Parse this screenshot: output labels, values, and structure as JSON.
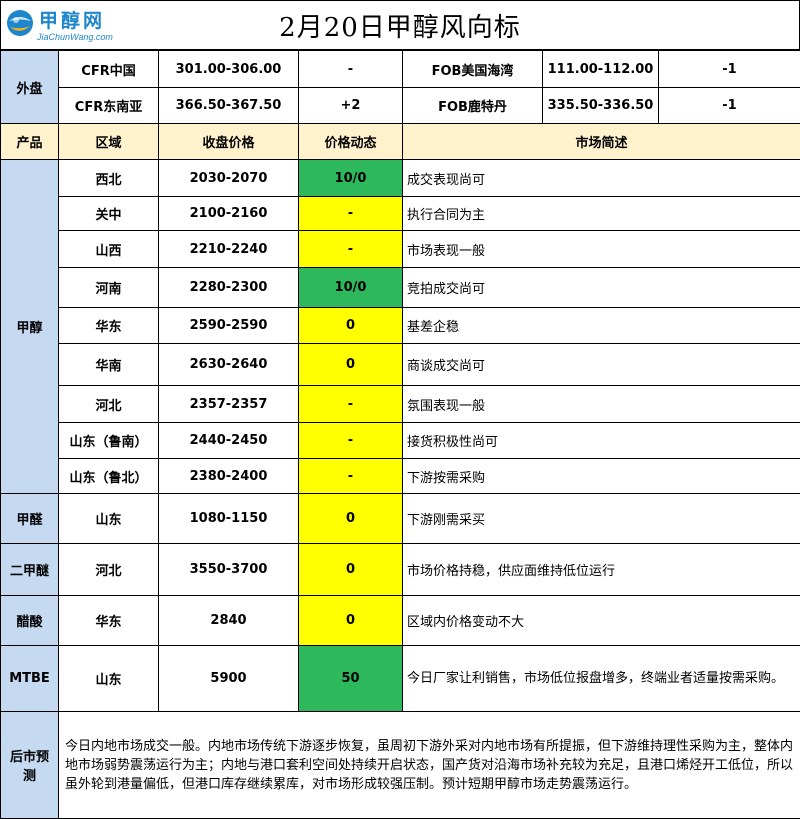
{
  "header": {
    "logo_text": "甲醇网",
    "logo_sub": "JiaChunWang.com",
    "title": "2月20日甲醇风向标"
  },
  "external": {
    "label": "外盘",
    "rows": [
      {
        "left_name": "CFR中国",
        "left_price": "301.00-306.00",
        "left_change": "-",
        "right_name": "FOB美国海湾",
        "right_price": "111.00-112.00",
        "right_change": "-1"
      },
      {
        "left_name": "CFR东南亚",
        "left_price": "366.50-367.50",
        "left_change": "+2",
        "right_name": "FOB鹿特丹",
        "right_price": "335.50-336.50",
        "right_change": "-1"
      }
    ]
  },
  "columns": {
    "product": "产品",
    "region": "区域",
    "price": "收盘价格",
    "change": "价格动态",
    "summary": "市场简述"
  },
  "methanol": {
    "product": "甲醇",
    "rows": [
      {
        "region": "西北",
        "price": "2030-2070",
        "change": "10/0",
        "summary": "成交表现尚可"
      },
      {
        "region": "关中",
        "price": "2100-2160",
        "change": "-",
        "summary": "执行合同为主"
      },
      {
        "region": "山西",
        "price": "2210-2240",
        "change": "-",
        "summary": "市场表现一般"
      },
      {
        "region": "河南",
        "price": "2280-2300",
        "change": "10/0",
        "summary": "竞拍成交尚可"
      },
      {
        "region": "华东",
        "price": "2590-2590",
        "change": "0",
        "summary": "基差企稳"
      },
      {
        "region": "华南",
        "price": "2630-2640",
        "change": "0",
        "summary": "商谈成交尚可"
      },
      {
        "region": "河北",
        "price": "2357-2357",
        "change": "-",
        "summary": "氛围表现一般"
      },
      {
        "region": "山东（鲁南）",
        "price": "2440-2450",
        "change": "-",
        "summary": "接货积极性尚可"
      },
      {
        "region": "山东（鲁北）",
        "price": "2380-2400",
        "change": "-",
        "summary": "下游按需采购"
      }
    ]
  },
  "others": [
    {
      "product": "甲醛",
      "region": "山东",
      "price": "1080-1150",
      "change": "0",
      "summary": "下游刚需采买"
    },
    {
      "product": "二甲醚",
      "region": "河北",
      "price": "3550-3700",
      "change": "0",
      "summary": "市场价格持稳，供应面维持低位运行"
    },
    {
      "product": "醋酸",
      "region": "华东",
      "price": "2840",
      "change": "0",
      "summary": "区域内价格变动不大"
    },
    {
      "product": "MTBE",
      "region": "山东",
      "price": "5900",
      "change": "50",
      "summary": "今日厂家让利销售，市场低位报盘增多，终端业者适量按需采购。"
    }
  ],
  "forecast": {
    "label": "后市预测",
    "text": "今日内地市场成交一般。内地市场传统下游逐步恢复，虽周初下游外采对内地市场有所提振，但下游维持理性采购为主，整体内地市场弱势震荡运行为主；内地与港口套利空间处持续开启状态，国产货对沿海市场补充较为充足，且港口烯烃开工低位，所以虽外轮到港量偏低，但港口库存继续累库，对市场形成较强压制。预计短期甲醇市场走势震荡运行。"
  },
  "colors": {
    "light_blue": "#c5d9f1",
    "light_yellow": "#fff2cc",
    "green": "#2eb85c",
    "yellow": "#ffff00",
    "logo_blue": "#1e86cc"
  }
}
